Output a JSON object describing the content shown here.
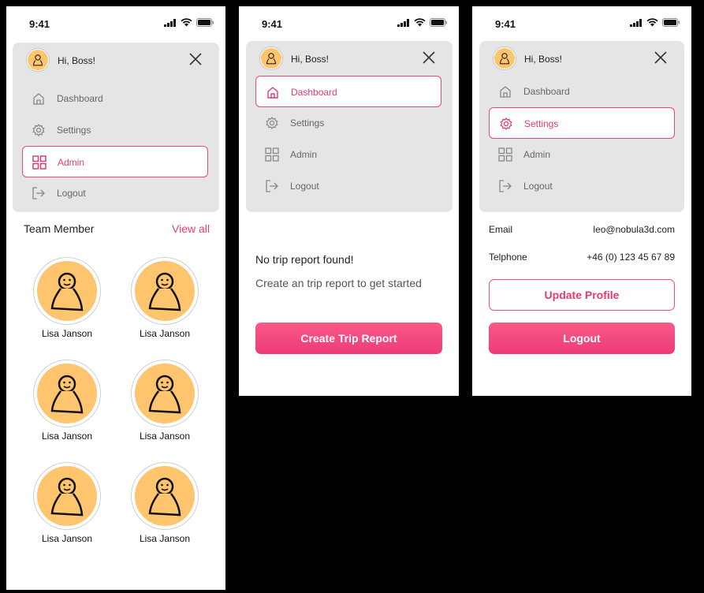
{
  "colors": {
    "accent": "#ee3b78",
    "avatar_fill": "#ffc46e",
    "menu_bg": "#e5e5e5"
  },
  "screens": [
    {
      "status": {
        "time": "9:41"
      },
      "menu": {
        "greeting": "Hi, Boss!",
        "items": [
          {
            "label": "Dashboard",
            "icon": "home-icon",
            "active": false
          },
          {
            "label": "Settings",
            "icon": "gear-icon",
            "active": false
          },
          {
            "label": "Admin",
            "icon": "grid-icon",
            "active": true
          },
          {
            "label": "Logout",
            "icon": "logout-icon",
            "active": false
          }
        ]
      },
      "team": {
        "title": "Team Member",
        "view_all": "View all",
        "members": [
          {
            "name": "Lisa Janson"
          },
          {
            "name": "Lisa Janson"
          },
          {
            "name": "Lisa Janson"
          },
          {
            "name": "Lisa Janson"
          },
          {
            "name": "Lisa Janson"
          },
          {
            "name": "Lisa Janson"
          }
        ]
      }
    },
    {
      "status": {
        "time": "9:41"
      },
      "menu": {
        "greeting": "Hi, Boss!",
        "items": [
          {
            "label": "Dashboard",
            "icon": "home-icon",
            "active": true
          },
          {
            "label": "Settings",
            "icon": "gear-icon",
            "active": false
          },
          {
            "label": "Admin",
            "icon": "grid-icon",
            "active": false
          },
          {
            "label": "Logout",
            "icon": "logout-icon",
            "active": false
          }
        ]
      },
      "empty": {
        "title": "No trip report found!",
        "subtitle": "Create an trip report to get started",
        "button": "Create Trip Report"
      }
    },
    {
      "status": {
        "time": "9:41"
      },
      "menu": {
        "greeting": "Hi, Boss!",
        "items": [
          {
            "label": "Dashboard",
            "icon": "home-icon",
            "active": false
          },
          {
            "label": "Settings",
            "icon": "gear-icon",
            "active": true
          },
          {
            "label": "Admin",
            "icon": "grid-icon",
            "active": false
          },
          {
            "label": "Logout",
            "icon": "logout-icon",
            "active": false
          }
        ]
      },
      "profile": {
        "email_label": "Email",
        "email_value": "leo@nobula3d.com",
        "phone_label": "Telphone",
        "phone_value": "+46 (0) 123 45 67 89",
        "update_button": "Update Profile",
        "logout_button": "Logout"
      }
    }
  ]
}
